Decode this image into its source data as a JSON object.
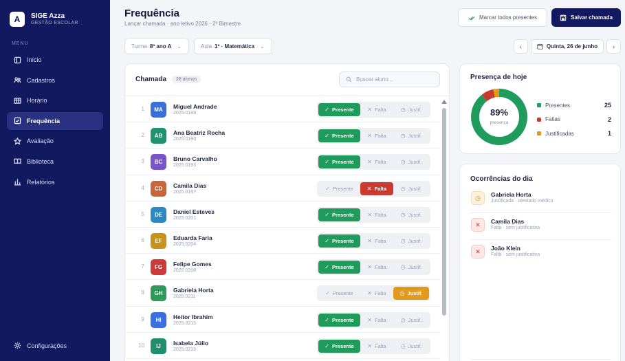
{
  "brand": {
    "logo_letter": "A",
    "name": "SIGE Azza",
    "subtitle": "GESTÃO ESCOLAR"
  },
  "sidebar": {
    "menu_label": "MENU",
    "items": [
      {
        "label": "Início",
        "icon": "home-icon",
        "active": false
      },
      {
        "label": "Cadastros",
        "icon": "users-icon",
        "active": false
      },
      {
        "label": "Horário",
        "icon": "calendar-grid-icon",
        "active": false
      },
      {
        "label": "Frequência",
        "icon": "clipboard-icon",
        "active": true
      },
      {
        "label": "Avaliação",
        "icon": "star-icon",
        "active": false
      },
      {
        "label": "Biblioteca",
        "icon": "book-icon",
        "active": false
      },
      {
        "label": "Relatórios",
        "icon": "bar-chart-icon",
        "active": false
      }
    ],
    "config_label": "Configurações"
  },
  "header": {
    "title": "Frequência",
    "subtitle": "Lançar chamada · ano letivo 2026 · 2º Bimestre",
    "mark_all_label": "Marcar todos presentes",
    "save_label": "Salvar chamada"
  },
  "filters": {
    "turma_label": "Turma",
    "turma_value": "8º ano A",
    "aula_label": "Aula",
    "aula_value": "1º · Matemática",
    "date_value": "Quinta, 26 de junho"
  },
  "roll": {
    "title": "Chamada",
    "count_badge": "28 alunos",
    "search_placeholder": "Buscar aluno...",
    "option_labels": {
      "present": "Presente",
      "absent": "Falta",
      "justified": "Justif."
    },
    "students": [
      {
        "num": "1",
        "initials": "MA",
        "name": "Miguel Andrade",
        "id": "2025.0188",
        "color": "#3b6fd8",
        "status": "present"
      },
      {
        "num": "2",
        "initials": "AB",
        "name": "Ana Beatriz Rocha",
        "id": "2025.0190",
        "color": "#1f9370",
        "status": "present"
      },
      {
        "num": "3",
        "initials": "BC",
        "name": "Bruno Carvalho",
        "id": "2025.0193",
        "color": "#7a55c9",
        "status": "present"
      },
      {
        "num": "4",
        "initials": "CD",
        "name": "Camila Dias",
        "id": "2025.0197",
        "color": "#c8683a",
        "status": "absent"
      },
      {
        "num": "5",
        "initials": "DE",
        "name": "Daniel Esteves",
        "id": "2025.0201",
        "color": "#2a8bc2",
        "status": "present"
      },
      {
        "num": "6",
        "initials": "EF",
        "name": "Eduarda Faria",
        "id": "2025.0204",
        "color": "#c9921a",
        "status": "present"
      },
      {
        "num": "7",
        "initials": "FG",
        "name": "Felipe Gomes",
        "id": "2025.0208",
        "color": "#cc3a3a",
        "status": "present"
      },
      {
        "num": "8",
        "initials": "GH",
        "name": "Gabriela Horta",
        "id": "2025.0211",
        "color": "#2f9a5a",
        "status": "justified"
      },
      {
        "num": "9",
        "initials": "HI",
        "name": "Heitor Ibrahim",
        "id": "2025.0215",
        "color": "#3a6fe0",
        "status": "present"
      },
      {
        "num": "10",
        "initials": "IJ",
        "name": "Isabela Júlio",
        "id": "2025.0218",
        "color": "#1f8f6e",
        "status": "present"
      }
    ]
  },
  "presence": {
    "title": "Presença de hoje",
    "percent": "89%",
    "percent_label": "presença",
    "legend": [
      {
        "label": "Presentes",
        "value": "25",
        "color": "#1f9b5c"
      },
      {
        "label": "Faltas",
        "value": "2",
        "color": "#cc3a2d"
      },
      {
        "label": "Justificadas",
        "value": "1",
        "color": "#e19b1c"
      }
    ]
  },
  "occurrences": {
    "title": "Ocorrências do dia",
    "items": [
      {
        "name": "Gabriela Horta",
        "desc": "Justificada · atestado médico",
        "kind": "just"
      },
      {
        "name": "Camila Dias",
        "desc": "Falta · sem justificativa",
        "kind": "falta"
      },
      {
        "name": "João Klein",
        "desc": "Falta · sem justificativa",
        "kind": "falta"
      }
    ]
  }
}
